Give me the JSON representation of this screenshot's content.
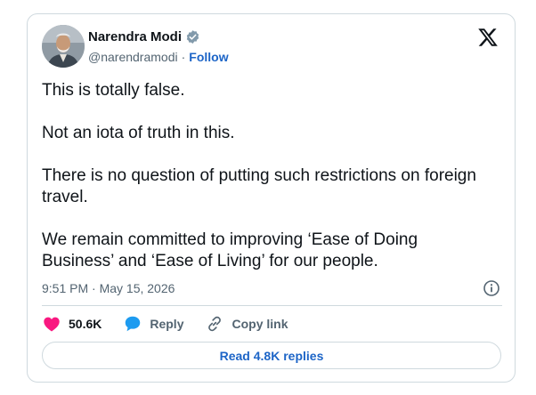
{
  "author": {
    "name": "Narendra Modi",
    "handle": "@narendramodi",
    "separator": "·",
    "follow_label": "Follow",
    "verified": true
  },
  "tweet": {
    "paragraphs": [
      "This is totally false.",
      "Not an iota of truth in this.",
      "There is no question of putting such restrictions on foreign travel.",
      "We remain committed to improving ‘Ease of Doing Business’ and ‘Ease of Living’ for our people."
    ],
    "timestamp": "9:51 PM · May 15, 2026"
  },
  "actions": {
    "likes": "50.6K",
    "reply_label": "Reply",
    "copy_link_label": "Copy link"
  },
  "read_replies_label": "Read 4.8K replies",
  "colors": {
    "text": "#0f1419",
    "muted": "#536471",
    "link": "#1d65c7",
    "like": "#f91880",
    "reply": "#1d9bf0",
    "border": "#cfd9de"
  },
  "icons": [
    "verified-badge-icon",
    "x-logo-icon",
    "info-icon",
    "heart-icon",
    "reply-bubble-icon",
    "link-icon"
  ]
}
